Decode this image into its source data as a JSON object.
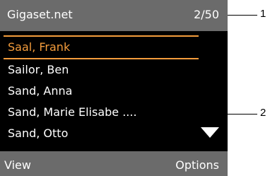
{
  "header": {
    "title": "Gigaset.net",
    "counter": "2/50"
  },
  "list": {
    "entries": [
      {
        "label": "Saal, Frank",
        "selected": true
      },
      {
        "label": "Sailor, Ben",
        "selected": false
      },
      {
        "label": "Sand, Anna",
        "selected": false
      },
      {
        "label": "Sand, Marie Elisabe ....",
        "selected": false
      },
      {
        "label": "Sand, Otto",
        "selected": false
      }
    ],
    "scroll_icon": "triangle-down-icon"
  },
  "softkeys": {
    "left": "View",
    "right": "Options"
  },
  "callouts": {
    "one": "1",
    "two": "2"
  },
  "colors": {
    "bar": "#6b6b6b",
    "screen": "#000000",
    "highlight": "#f39c3c",
    "text": "#ffffff"
  }
}
